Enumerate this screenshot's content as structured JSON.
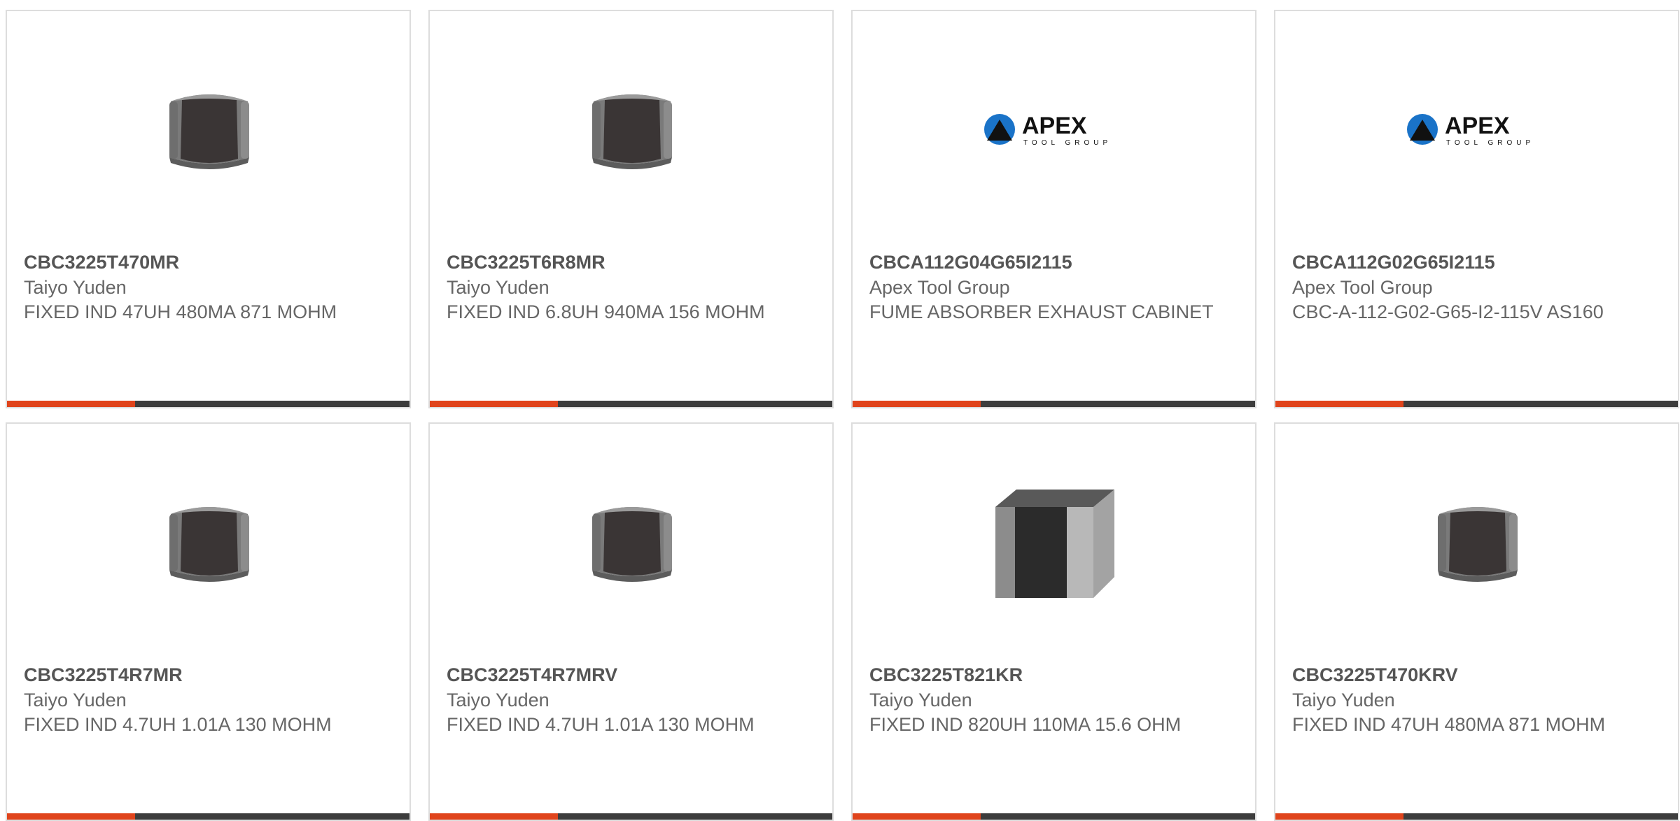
{
  "colors": {
    "accent": "#e0441c",
    "bar": "#3d3d3d",
    "border": "#dddddd",
    "text": "#666666",
    "apex_blue": "#1a73c8"
  },
  "products": [
    {
      "part_number": "CBC3225T470MR",
      "manufacturer": "Taiyo Yuden",
      "description": "FIXED IND 47UH 480MA 871 MOHM",
      "image_icon": "inductor-chip-icon"
    },
    {
      "part_number": "CBC3225T6R8MR",
      "manufacturer": "Taiyo Yuden",
      "description": "FIXED IND 6.8UH 940MA 156 MOHM",
      "image_icon": "inductor-chip-icon"
    },
    {
      "part_number": "CBCA112G04G65I2115",
      "manufacturer": "Apex Tool Group",
      "description": "FUME ABSORBER EXHAUST CABINET",
      "image_icon": "apex-logo",
      "logo_text": "APEX",
      "logo_subtext": "TOOL GROUP"
    },
    {
      "part_number": "CBCA112G02G65I2115",
      "manufacturer": "Apex Tool Group",
      "description": "CBC-A-112-G02-G65-I2-115V AS160",
      "image_icon": "apex-logo",
      "logo_text": "APEX",
      "logo_subtext": "TOOL GROUP"
    },
    {
      "part_number": "CBC3225T4R7MR",
      "manufacturer": "Taiyo Yuden",
      "description": "FIXED IND 4.7UH 1.01A 130 MOHM",
      "image_icon": "inductor-chip-icon"
    },
    {
      "part_number": "CBC3225T4R7MRV",
      "manufacturer": "Taiyo Yuden",
      "description": "FIXED IND 4.7UH 1.01A 130 MOHM",
      "image_icon": "inductor-chip-icon"
    },
    {
      "part_number": "CBC3225T821KR",
      "manufacturer": "Taiyo Yuden",
      "description": "FIXED IND 820UH 110MA 15.6 OHM",
      "image_icon": "inductor-block-icon"
    },
    {
      "part_number": "CBC3225T470KRV",
      "manufacturer": "Taiyo Yuden",
      "description": "FIXED IND 47UH 480MA 871 MOHM",
      "image_icon": "inductor-chip-icon"
    }
  ]
}
